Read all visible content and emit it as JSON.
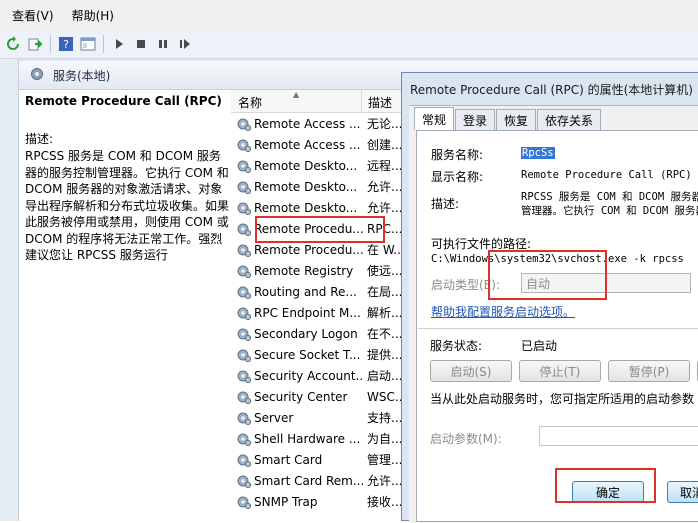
{
  "menu": {
    "view": "查看(V)",
    "help": "帮助(H)"
  },
  "toolbar": {
    "icons": [
      "refresh-icon",
      "export-icon",
      "help-icon",
      "console-icon",
      "play-icon",
      "stop-icon",
      "pause-icon",
      "restart-icon"
    ]
  },
  "panel": {
    "title": "服务(本地)"
  },
  "description": {
    "service_name": "Remote Procedure Call (RPC)",
    "label": "描述:",
    "text": "RPCSS 服务是 COM 和 DCOM 服务器的服务控制管理器。它执行 COM 和 DCOM 服务器的对象激活请求、对象导出程序解析和分布式垃圾收集。如果此服务被停用或禁用，则使用 COM 或 DCOM 的程序将无法正常工作。强烈建议您让 RPCSS 服务运行"
  },
  "list": {
    "col_name": "名称",
    "col_desc": "描述",
    "rows": [
      {
        "name": "Remote Access ...",
        "desc": "无论..."
      },
      {
        "name": "Remote Access ...",
        "desc": "创建..."
      },
      {
        "name": "Remote Deskto...",
        "desc": "远程..."
      },
      {
        "name": "Remote Deskto...",
        "desc": "允许..."
      },
      {
        "name": "Remote Deskto...",
        "desc": "允许..."
      },
      {
        "name": "Remote Procedu...",
        "desc": "RPC..."
      },
      {
        "name": "Remote Procedu...",
        "desc": "在 W..."
      },
      {
        "name": "Remote Registry",
        "desc": "使远..."
      },
      {
        "name": "Routing and Re...",
        "desc": "在局..."
      },
      {
        "name": "RPC Endpoint M...",
        "desc": "解析..."
      },
      {
        "name": "Secondary Logon",
        "desc": "在不..."
      },
      {
        "name": "Secure Socket T...",
        "desc": "提供..."
      },
      {
        "name": "Security Account...",
        "desc": "启动..."
      },
      {
        "name": "Security Center",
        "desc": "WSC..."
      },
      {
        "name": "Server",
        "desc": "支持..."
      },
      {
        "name": "Shell Hardware ...",
        "desc": "为自..."
      },
      {
        "name": "Smart Card",
        "desc": "管理..."
      },
      {
        "name": "Smart Card Rem...",
        "desc": "允许..."
      },
      {
        "name": "SNMP Trap",
        "desc": "接收..."
      }
    ]
  },
  "dialog": {
    "title": "Remote Procedure Call (RPC) 的属性(本地计算机)",
    "tabs": [
      "常规",
      "登录",
      "恢复",
      "依存关系"
    ],
    "service_name_label": "服务名称:",
    "service_name_value": "RpcSs",
    "display_name_label": "显示名称:",
    "display_name_value": "Remote Procedure Call (RPC)",
    "desc_label": "描述:",
    "desc_value_line1": "RPCSS 服务是 COM 和 DCOM 服务器",
    "desc_value_line2": "管理器。它执行 COM 和 DCOM 服务器",
    "exe_path_label": "可执行文件的路径:",
    "exe_path_value": "C:\\Windows\\system32\\svchost.exe -k rpcss",
    "startup_type_label": "启动类型(E):",
    "startup_type_value": "自动",
    "help_link": "帮助我配置服务启动选项。",
    "status_label": "服务状态:",
    "status_value": "已启动",
    "start_button": "启动(S)",
    "stop_button": "停止(T)",
    "pause_button": "暂停(P)",
    "resume_button": "恢",
    "start_hint": "当从此处启动服务时，您可指定所适用的启动参数",
    "params_label": "启动参数(M):",
    "ok_button": "确定",
    "cancel_button": "取消"
  }
}
